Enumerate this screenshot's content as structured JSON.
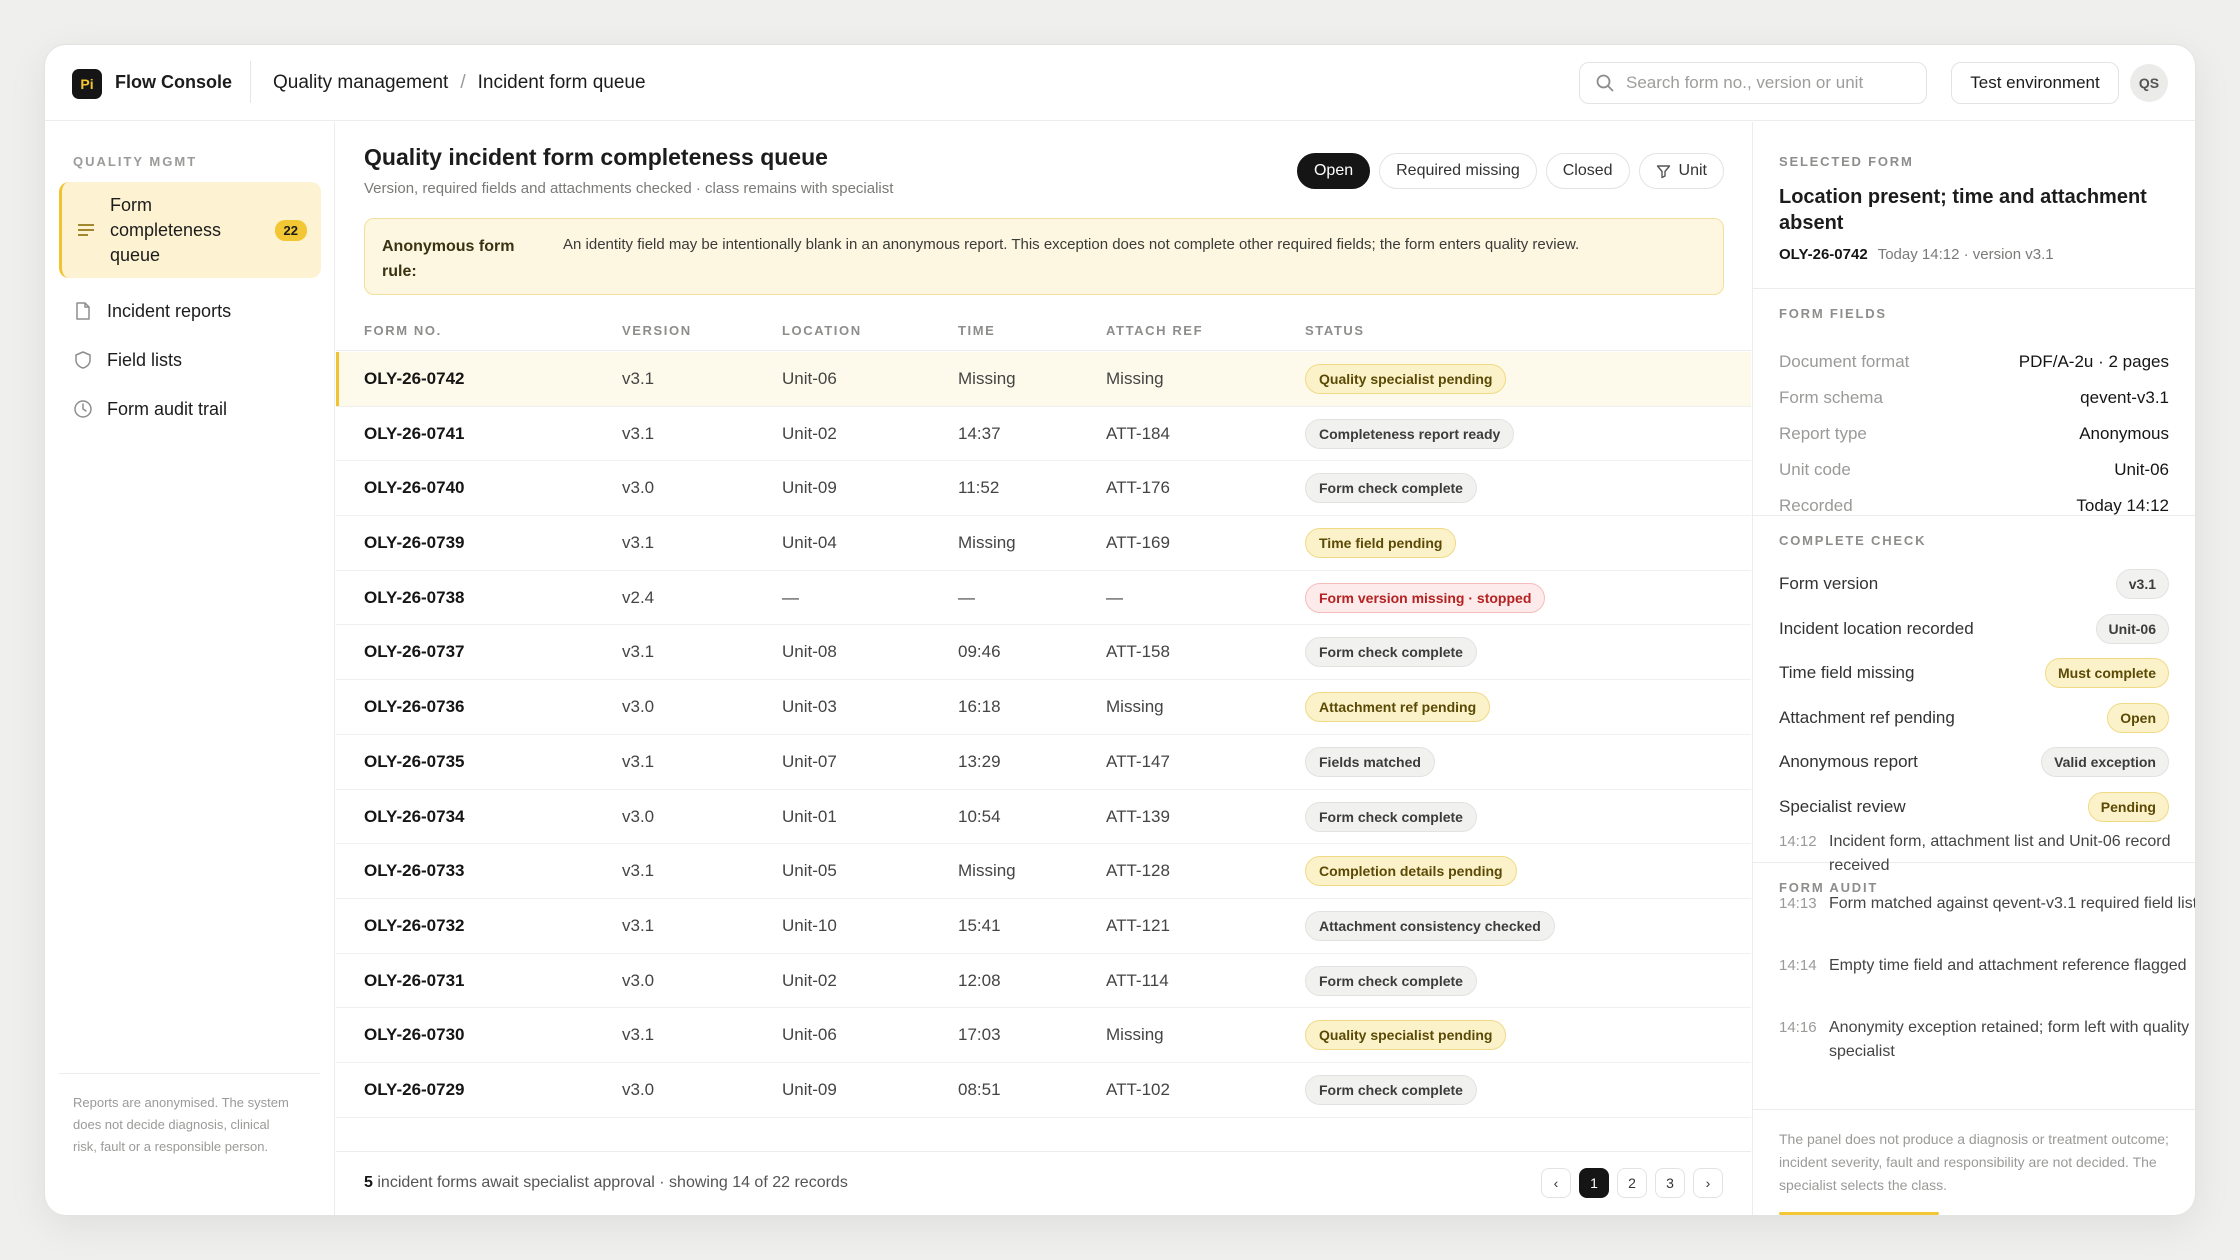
{
  "app": {
    "logo": "Pi",
    "name": "Flow Console"
  },
  "breadcrumb": {
    "section": "Quality management",
    "separator": "/",
    "page": "Incident form queue"
  },
  "search": {
    "placeholder": "Search form no., version or unit"
  },
  "environment": "Test environment",
  "user_initials": "QS",
  "sidebar": {
    "heading": "QUALITY MGMT",
    "items": [
      {
        "label": "Form completeness queue",
        "badge": "22",
        "icon": "list-icon"
      },
      {
        "label": "Incident reports",
        "icon": "document-icon"
      },
      {
        "label": "Field lists",
        "icon": "shield-icon"
      },
      {
        "label": "Form audit trail",
        "icon": "clock-icon"
      }
    ],
    "note": "Reports are anonymised. The system does not decide diagnosis, clinical risk, fault or a responsible person."
  },
  "main": {
    "title": "Quality incident form completeness queue",
    "subtitle": "Version, required fields and attachments checked · class remains with specialist",
    "filters": [
      "Open",
      "Required missing",
      "Closed",
      "Unit"
    ],
    "rule_label": "Anonymous form rule:",
    "rule_text": "An identity field may be intentionally blank in an anonymous report. This exception does not complete other required fields; the form enters quality review.",
    "columns": [
      "FORM NO.",
      "VERSION",
      "LOCATION",
      "TIME",
      "ATTACH REF",
      "STATUS"
    ],
    "rows": [
      {
        "no": "OLY-26-0742",
        "version": "v3.1",
        "location": "Unit-06",
        "time": "Missing",
        "attach": "Missing",
        "status": "Quality specialist pending",
        "tone": "yellow"
      },
      {
        "no": "OLY-26-0741",
        "version": "v3.1",
        "location": "Unit-02",
        "time": "14:37",
        "attach": "ATT-184",
        "status": "Completeness report ready",
        "tone": "gray"
      },
      {
        "no": "OLY-26-0740",
        "version": "v3.0",
        "location": "Unit-09",
        "time": "11:52",
        "attach": "ATT-176",
        "status": "Form check complete",
        "tone": "gray"
      },
      {
        "no": "OLY-26-0739",
        "version": "v3.1",
        "location": "Unit-04",
        "time": "Missing",
        "attach": "ATT-169",
        "status": "Time field pending",
        "tone": "yellow"
      },
      {
        "no": "OLY-26-0738",
        "version": "v2.4",
        "location": "—",
        "time": "—",
        "attach": "—",
        "status": "Form version missing · stopped",
        "tone": "red"
      },
      {
        "no": "OLY-26-0737",
        "version": "v3.1",
        "location": "Unit-08",
        "time": "09:46",
        "attach": "ATT-158",
        "status": "Form check complete",
        "tone": "gray"
      },
      {
        "no": "OLY-26-0736",
        "version": "v3.0",
        "location": "Unit-03",
        "time": "16:18",
        "attach": "Missing",
        "status": "Attachment ref pending",
        "tone": "yellow"
      },
      {
        "no": "OLY-26-0735",
        "version": "v3.1",
        "location": "Unit-07",
        "time": "13:29",
        "attach": "ATT-147",
        "status": "Fields matched",
        "tone": "gray"
      },
      {
        "no": "OLY-26-0734",
        "version": "v3.0",
        "location": "Unit-01",
        "time": "10:54",
        "attach": "ATT-139",
        "status": "Form check complete",
        "tone": "gray"
      },
      {
        "no": "OLY-26-0733",
        "version": "v3.1",
        "location": "Unit-05",
        "time": "Missing",
        "attach": "ATT-128",
        "status": "Completion details pending",
        "tone": "yellow"
      },
      {
        "no": "OLY-26-0732",
        "version": "v3.1",
        "location": "Unit-10",
        "time": "15:41",
        "attach": "ATT-121",
        "status": "Attachment consistency checked",
        "tone": "gray"
      },
      {
        "no": "OLY-26-0731",
        "version": "v3.0",
        "location": "Unit-02",
        "time": "12:08",
        "attach": "ATT-114",
        "status": "Form check complete",
        "tone": "gray"
      },
      {
        "no": "OLY-26-0730",
        "version": "v3.1",
        "location": "Unit-06",
        "time": "17:03",
        "attach": "Missing",
        "status": "Quality specialist pending",
        "tone": "yellow"
      },
      {
        "no": "OLY-26-0729",
        "version": "v3.0",
        "location": "Unit-09",
        "time": "08:51",
        "attach": "ATT-102",
        "status": "Form check complete",
        "tone": "gray"
      }
    ],
    "footer_count": "5",
    "footer_text": "incident forms await specialist approval · showing 14 of 22 records",
    "pages": [
      "‹",
      "1",
      "2",
      "3",
      "›"
    ]
  },
  "panel": {
    "selected_heading": "SELECTED FORM",
    "selected_title": "Location present; time and attachment absent",
    "selected_no": "OLY-26-0742",
    "selected_meta": "Today 14:12 · version v3.1",
    "fields_heading": "FORM FIELDS",
    "fields": [
      {
        "k": "Document format",
        "v": "PDF/A-2u · 2 pages"
      },
      {
        "k": "Form schema",
        "v": "qevent-v3.1"
      },
      {
        "k": "Report type",
        "v": "Anonymous"
      },
      {
        "k": "Unit code",
        "v": "Unit-06"
      },
      {
        "k": "Recorded",
        "v": "Today 14:12"
      }
    ],
    "check_heading": "COMPLETE CHECK",
    "checks": [
      {
        "label": "Form version",
        "badge": "v3.1",
        "tone": "g"
      },
      {
        "label": "Incident location recorded",
        "badge": "Unit-06",
        "tone": "g"
      },
      {
        "label": "Time field missing",
        "badge": "Must complete",
        "tone": "y"
      },
      {
        "label": "Attachment ref pending",
        "badge": "Open",
        "tone": "y"
      },
      {
        "label": "Anonymous report",
        "badge": "Valid exception",
        "tone": "g"
      },
      {
        "label": "Specialist review",
        "badge": "Pending",
        "tone": "y"
      }
    ],
    "audit_heading": "FORM AUDIT",
    "audit": [
      {
        "t": "14:12",
        "d": "Incident form, attachment list and Unit-06 record received"
      },
      {
        "t": "14:13",
        "d": "Form matched against qevent-v3.1 required field list"
      },
      {
        "t": "14:14",
        "d": "Empty time field and attachment reference flagged"
      },
      {
        "t": "14:16",
        "d": "Anonymity exception retained; form left with quality specialist"
      }
    ],
    "note": "The panel does not produce a diagnosis or treatment outcome; incident severity, fault and responsibility are not decided. The specialist selects the class."
  },
  "colors": {
    "accent": "#f3c634",
    "dark": "#151515",
    "warn_bg": "#fcf2c9",
    "error": "#b42222"
  }
}
